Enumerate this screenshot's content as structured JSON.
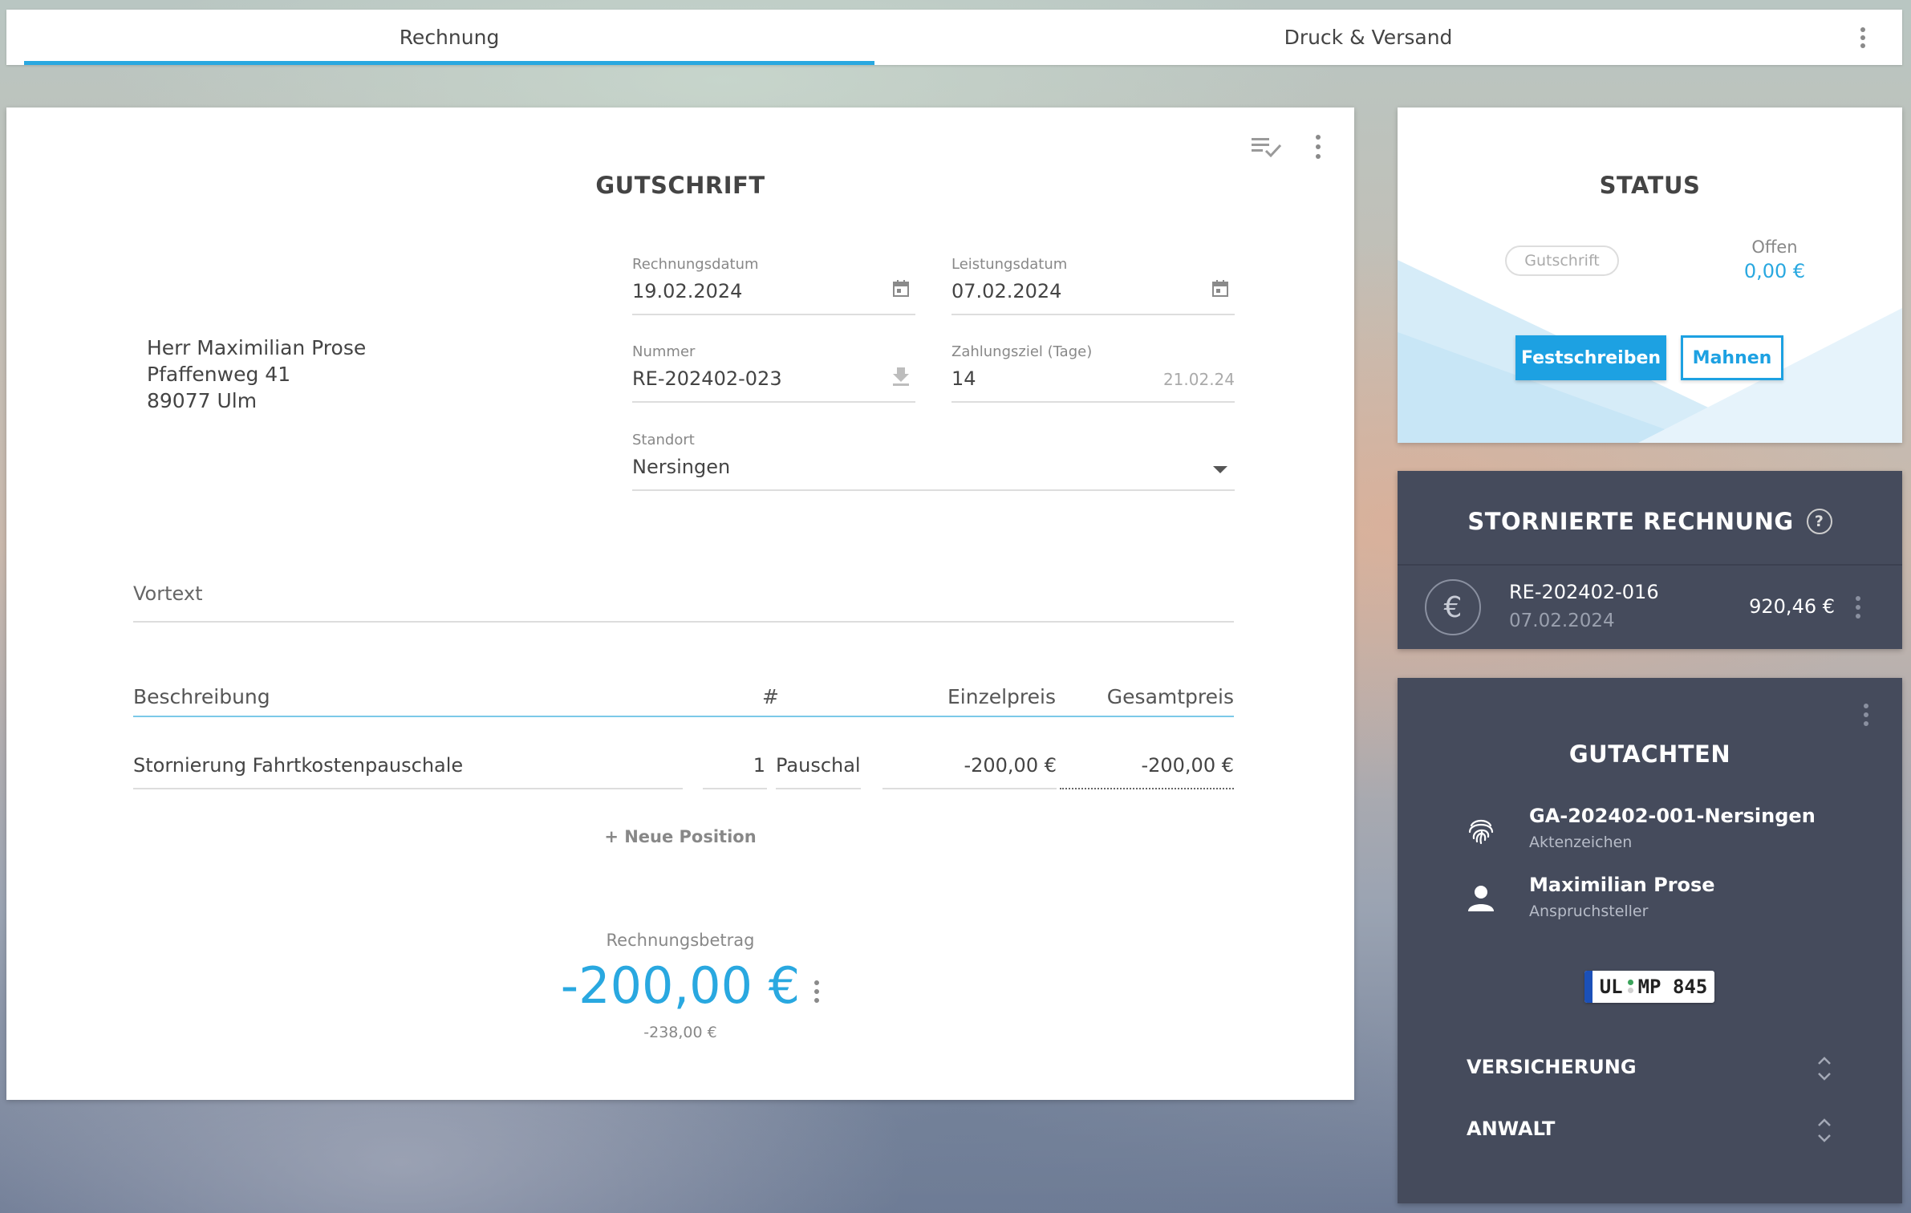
{
  "tabs": [
    {
      "label": "Rechnung",
      "active": true
    },
    {
      "label": "Druck & Versand",
      "active": false
    }
  ],
  "invoice": {
    "title": "GUTSCHRIFT",
    "address": [
      "Herr Maximilian Prose",
      "Pfaffenweg 41",
      "89077 Ulm"
    ],
    "fields": {
      "rechnungsdatum": {
        "label": "Rechnungsdatum",
        "value": "19.02.2024"
      },
      "leistungsdatum": {
        "label": "Leistungsdatum",
        "value": "07.02.2024"
      },
      "nummer": {
        "label": "Nummer",
        "value": "RE-202402-023"
      },
      "zahlungsziel": {
        "label": "Zahlungsziel (Tage)",
        "value": "14",
        "hint": "21.02.24"
      },
      "standort": {
        "label": "Standort",
        "value": "Nersingen"
      }
    },
    "vortext_placeholder": "Vortext",
    "table": {
      "headers": {
        "beschreibung": "Beschreibung",
        "anzahl": "#",
        "einzelpreis": "Einzelpreis",
        "gesamtpreis": "Gesamtpreis"
      },
      "rows": [
        {
          "beschreibung": "Stornierung Fahrtkostenpauschale",
          "anzahl": "1",
          "einheit": "Pauschal",
          "einzelpreis": "-200,00 €",
          "gesamtpreis": "-200,00 €"
        }
      ]
    },
    "add_position_label": "+ Neue Position",
    "betrag_label": "Rechnungsbetrag",
    "betrag": "-200,00 €",
    "betrag_brutto": "-238,00 €"
  },
  "status": {
    "title": "STATUS",
    "chip": "Gutschrift",
    "offen_label": "Offen",
    "offen_value": "0,00 €",
    "btn_festschreiben": "Festschreiben",
    "btn_mahnen": "Mahnen"
  },
  "storno": {
    "title": "STORNIERTE RECHNUNG",
    "help": "?",
    "number": "RE-202402-016",
    "date": "07.02.2024",
    "amount": "920,46 €"
  },
  "gutachten": {
    "title": "GUTACHTEN",
    "aktenzeichen": "GA-202402-001-Nersingen",
    "aktenzeichen_label": "Aktenzeichen",
    "anspruchsteller": "Maximilian Prose",
    "anspruchsteller_label": "Anspruchsteller",
    "plate_left": "UL",
    "plate_right": "MP 845",
    "sections": [
      "VERSICHERUNG",
      "ANWALT"
    ]
  },
  "colors": {
    "accent": "#29a8e0",
    "dark_card": "#454b5c"
  }
}
